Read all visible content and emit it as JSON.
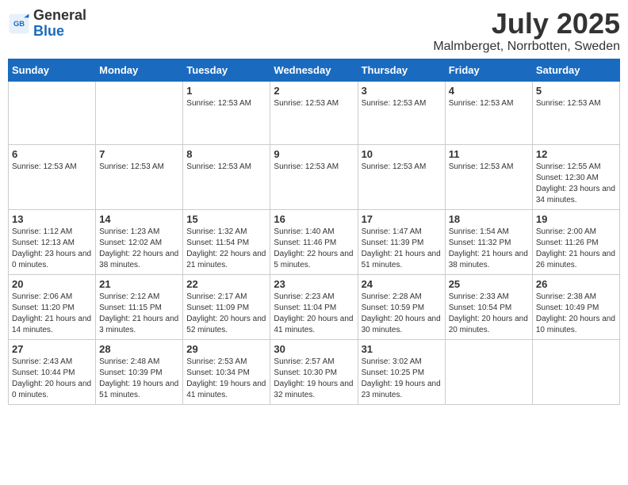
{
  "header": {
    "logo_line1": "General",
    "logo_line2": "Blue",
    "month": "July 2025",
    "location": "Malmberget, Norrbotten, Sweden"
  },
  "weekdays": [
    "Sunday",
    "Monday",
    "Tuesday",
    "Wednesday",
    "Thursday",
    "Friday",
    "Saturday"
  ],
  "weeks": [
    [
      {
        "day": "",
        "info": ""
      },
      {
        "day": "",
        "info": ""
      },
      {
        "day": "1",
        "info": "Sunrise: 12:53 AM"
      },
      {
        "day": "2",
        "info": "Sunrise: 12:53 AM"
      },
      {
        "day": "3",
        "info": "Sunrise: 12:53 AM"
      },
      {
        "day": "4",
        "info": "Sunrise: 12:53 AM"
      },
      {
        "day": "5",
        "info": "Sunrise: 12:53 AM"
      }
    ],
    [
      {
        "day": "6",
        "info": "Sunrise: 12:53 AM"
      },
      {
        "day": "7",
        "info": "Sunrise: 12:53 AM"
      },
      {
        "day": "8",
        "info": "Sunrise: 12:53 AM"
      },
      {
        "day": "9",
        "info": "Sunrise: 12:53 AM"
      },
      {
        "day": "10",
        "info": "Sunrise: 12:53 AM"
      },
      {
        "day": "11",
        "info": "Sunrise: 12:53 AM"
      },
      {
        "day": "12",
        "info": "Sunrise: 12:55 AM\nSunset: 12:30 AM\nDaylight: 23 hours and 34 minutes."
      }
    ],
    [
      {
        "day": "13",
        "info": "Sunrise: 1:12 AM\nSunset: 12:13 AM\nDaylight: 23 hours and 0 minutes."
      },
      {
        "day": "14",
        "info": "Sunrise: 1:23 AM\nSunset: 12:02 AM\nDaylight: 22 hours and 38 minutes."
      },
      {
        "day": "15",
        "info": "Sunrise: 1:32 AM\nSunset: 11:54 PM\nDaylight: 22 hours and 21 minutes."
      },
      {
        "day": "16",
        "info": "Sunrise: 1:40 AM\nSunset: 11:46 PM\nDaylight: 22 hours and 5 minutes."
      },
      {
        "day": "17",
        "info": "Sunrise: 1:47 AM\nSunset: 11:39 PM\nDaylight: 21 hours and 51 minutes."
      },
      {
        "day": "18",
        "info": "Sunrise: 1:54 AM\nSunset: 11:32 PM\nDaylight: 21 hours and 38 minutes."
      },
      {
        "day": "19",
        "info": "Sunrise: 2:00 AM\nSunset: 11:26 PM\nDaylight: 21 hours and 26 minutes."
      }
    ],
    [
      {
        "day": "20",
        "info": "Sunrise: 2:06 AM\nSunset: 11:20 PM\nDaylight: 21 hours and 14 minutes."
      },
      {
        "day": "21",
        "info": "Sunrise: 2:12 AM\nSunset: 11:15 PM\nDaylight: 21 hours and 3 minutes."
      },
      {
        "day": "22",
        "info": "Sunrise: 2:17 AM\nSunset: 11:09 PM\nDaylight: 20 hours and 52 minutes."
      },
      {
        "day": "23",
        "info": "Sunrise: 2:23 AM\nSunset: 11:04 PM\nDaylight: 20 hours and 41 minutes."
      },
      {
        "day": "24",
        "info": "Sunrise: 2:28 AM\nSunset: 10:59 PM\nDaylight: 20 hours and 30 minutes."
      },
      {
        "day": "25",
        "info": "Sunrise: 2:33 AM\nSunset: 10:54 PM\nDaylight: 20 hours and 20 minutes."
      },
      {
        "day": "26",
        "info": "Sunrise: 2:38 AM\nSunset: 10:49 PM\nDaylight: 20 hours and 10 minutes."
      }
    ],
    [
      {
        "day": "27",
        "info": "Sunrise: 2:43 AM\nSunset: 10:44 PM\nDaylight: 20 hours and 0 minutes."
      },
      {
        "day": "28",
        "info": "Sunrise: 2:48 AM\nSunset: 10:39 PM\nDaylight: 19 hours and 51 minutes."
      },
      {
        "day": "29",
        "info": "Sunrise: 2:53 AM\nSunset: 10:34 PM\nDaylight: 19 hours and 41 minutes."
      },
      {
        "day": "30",
        "info": "Sunrise: 2:57 AM\nSunset: 10:30 PM\nDaylight: 19 hours and 32 minutes."
      },
      {
        "day": "31",
        "info": "Sunrise: 3:02 AM\nSunset: 10:25 PM\nDaylight: 19 hours and 23 minutes."
      },
      {
        "day": "",
        "info": ""
      },
      {
        "day": "",
        "info": ""
      }
    ]
  ]
}
